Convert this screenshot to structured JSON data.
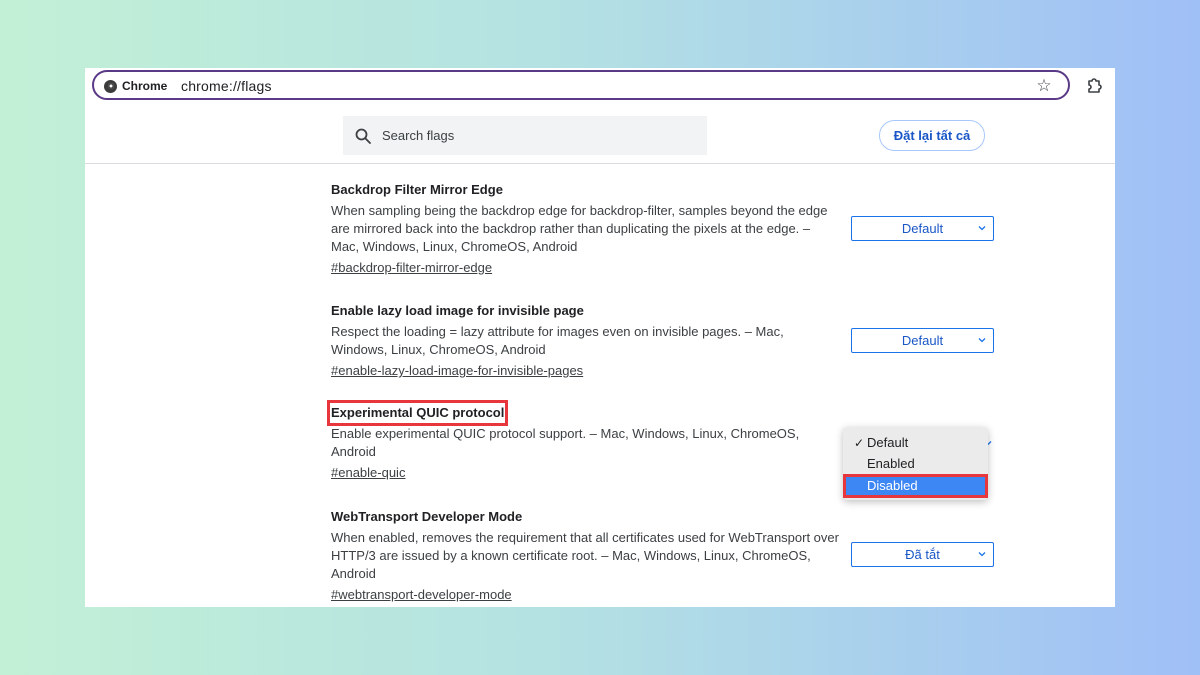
{
  "browser": {
    "chip_label": "Chrome",
    "url_scheme": "chrome://",
    "url_host": "flags"
  },
  "search": {
    "placeholder": "Search flags"
  },
  "reset_button": {
    "label": "Đặt lại tất cả"
  },
  "flags": [
    {
      "title": "Backdrop Filter Mirror Edge",
      "description": "When sampling being the backdrop edge for backdrop-filter, samples beyond the edge are mirrored back into the backdrop rather than duplicating the pixels at the edge. – Mac, Windows, Linux, ChromeOS, Android",
      "link": "#backdrop-filter-mirror-edge",
      "value": "Default"
    },
    {
      "title": "Enable lazy load image for invisible page",
      "description": "Respect the loading = lazy attribute for images even on invisible pages. – Mac, Windows, Linux, ChromeOS, Android",
      "link": "#enable-lazy-load-image-for-invisible-pages",
      "value": "Default"
    },
    {
      "title": "Experimental QUIC protocol",
      "description": "Enable experimental QUIC protocol support. – Mac, Windows, Linux, ChromeOS, Android",
      "link": "#enable-quic",
      "value": "Default"
    },
    {
      "title": "WebTransport Developer Mode",
      "description": "When enabled, removes the requirement that all certificates used for WebTransport over HTTP/3 are issued by a known certificate root. – Mac, Windows, Linux, ChromeOS, Android",
      "link": "#webtransport-developer-mode",
      "value": "Đã tắt"
    }
  ],
  "dropdown": {
    "options": [
      {
        "label": "Default",
        "checked": true
      },
      {
        "label": "Enabled",
        "checked": false
      },
      {
        "label": "Disabled",
        "checked": false,
        "highlighted": true
      }
    ],
    "check_mark": "✓"
  },
  "colors": {
    "accent": "#1a73e8",
    "highlight_box": "#e8373c",
    "menu_highlight": "#3d87f5"
  }
}
